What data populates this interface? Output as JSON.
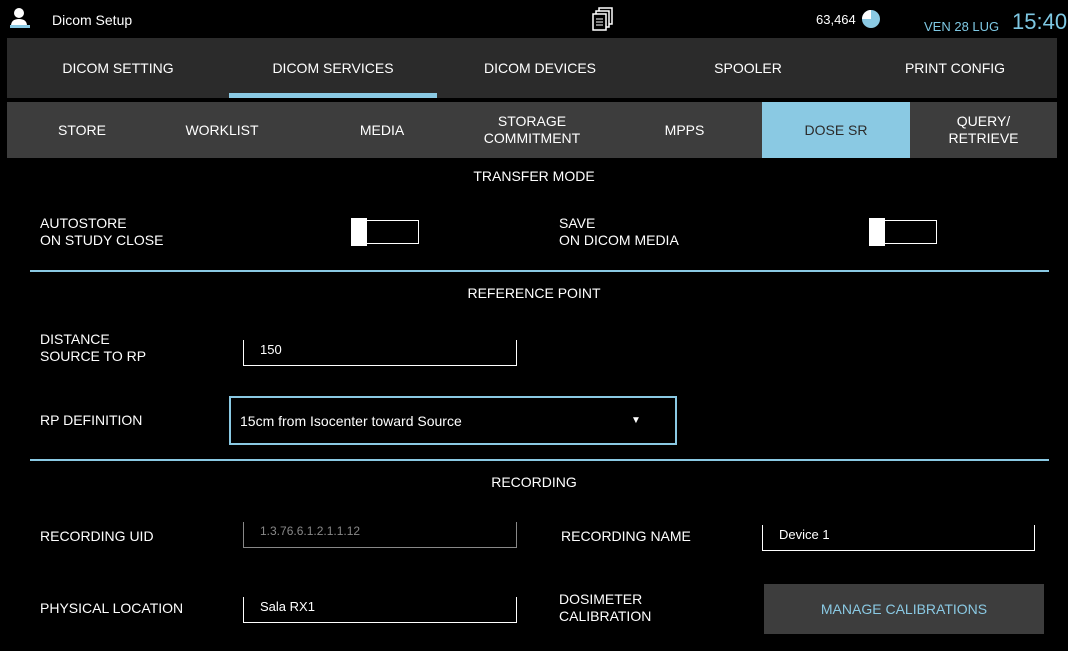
{
  "titlebar": {
    "app_title": "Dicom Setup",
    "counter": "63,464",
    "date": "VEN 28 LUG",
    "time": "15:40",
    "accent_color": "#8ac9e3"
  },
  "main_tabs": [
    {
      "label": "DICOM SETTING"
    },
    {
      "label": "DICOM SERVICES",
      "selected": true
    },
    {
      "label": "DICOM DEVICES"
    },
    {
      "label": "SPOOLER"
    },
    {
      "label": "PRINT CONFIG"
    }
  ],
  "sub_tabs": [
    {
      "label": "STORE"
    },
    {
      "label": "WORKLIST"
    },
    {
      "label": "MEDIA"
    },
    {
      "label": "STORAGE\nCOMMITMENT"
    },
    {
      "label": "MPPS"
    },
    {
      "label": "DOSE SR",
      "selected": true
    },
    {
      "label": "QUERY/\nRETRIEVE"
    }
  ],
  "transfer_mode": {
    "title": "TRANSFER MODE",
    "autostore_label": "AUTOSTORE\nON STUDY CLOSE",
    "autostore_on": false,
    "save_label": "SAVE\nON DICOM MEDIA",
    "save_on": false
  },
  "reference_point": {
    "title": "REFERENCE POINT",
    "distance_label": "DISTANCE\nSOURCE TO RP",
    "distance_value": "150",
    "rp_definition_label": "RP DEFINITION",
    "rp_definition_value": "15cm from Isocenter toward Source"
  },
  "recording": {
    "title": "RECORDING",
    "uid_label": "RECORDING UID",
    "uid_value": "1.3.76.6.1.2.1.1.12",
    "name_label": "RECORDING NAME",
    "name_value": "Device 1",
    "location_label": "PHYSICAL LOCATION",
    "location_value": "Sala RX1",
    "dosimeter_label": "DOSIMETER\nCALIBRATION",
    "manage_button": "MANAGE CALIBRATIONS"
  },
  "icons": {
    "app": "user-icon",
    "copy": "copy-pages-icon",
    "disk": "disk-usage-icon",
    "dropdown": "caret-down-icon"
  }
}
